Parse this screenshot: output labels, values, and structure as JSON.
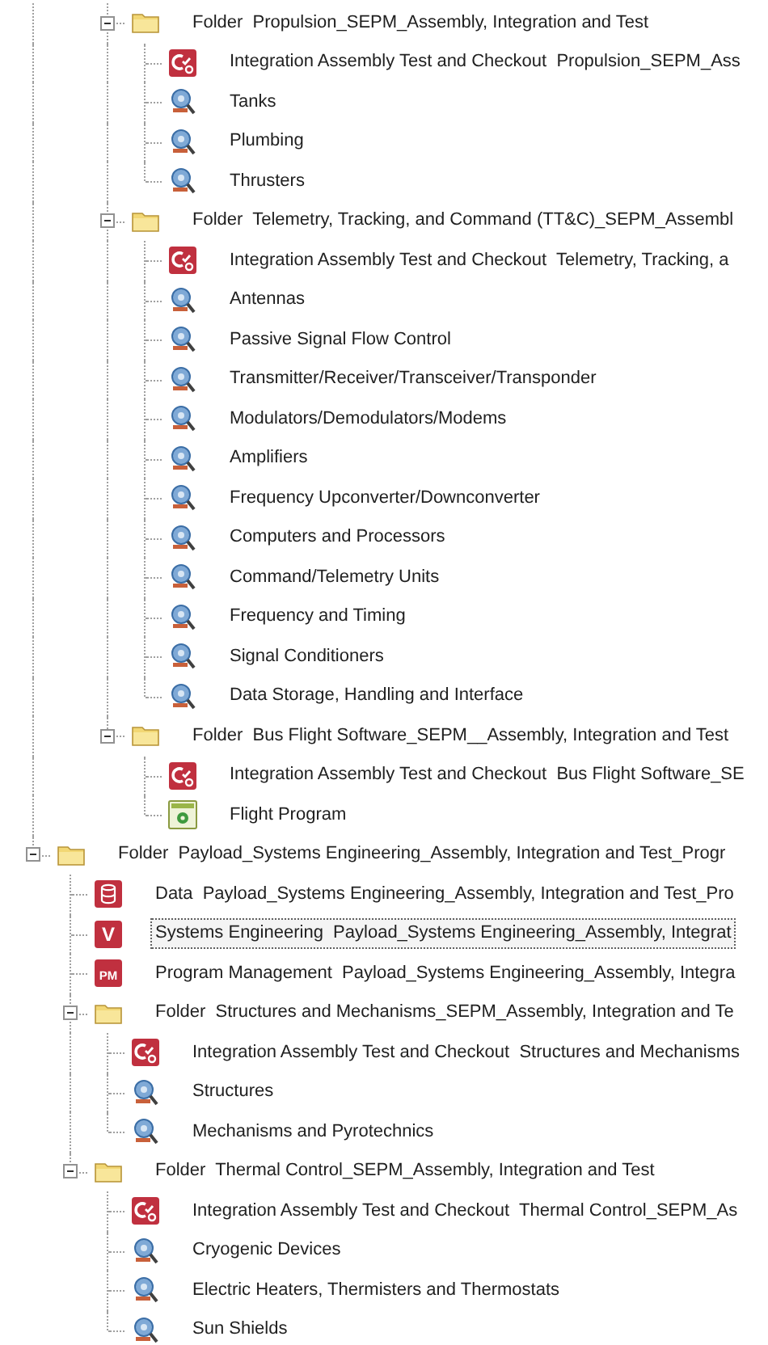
{
  "partial_branch": [
    {
      "kind": "folder",
      "label": "Folder  Propulsion_SEPM_Assembly, Integration and Test",
      "expanded": true,
      "selected": false,
      "children": [
        {
          "kind": "checkout",
          "label": "Integration Assembly Test and Checkout  Propulsion_SEPM_Ass",
          "selected": false
        },
        {
          "kind": "component",
          "label": "Tanks",
          "selected": false
        },
        {
          "kind": "component",
          "label": "Plumbing",
          "selected": false
        },
        {
          "kind": "component",
          "label": "Thrusters",
          "selected": false
        }
      ]
    },
    {
      "kind": "folder",
      "label": "Folder  Telemetry, Tracking, and Command (TT&C)_SEPM_Assembl",
      "expanded": true,
      "selected": false,
      "children": [
        {
          "kind": "checkout",
          "label": "Integration Assembly Test and Checkout  Telemetry, Tracking, a",
          "selected": false
        },
        {
          "kind": "component",
          "label": "Antennas",
          "selected": false
        },
        {
          "kind": "component",
          "label": "Passive Signal Flow Control",
          "selected": false
        },
        {
          "kind": "component",
          "label": "Transmitter/Receiver/Transceiver/Transponder",
          "selected": false
        },
        {
          "kind": "component",
          "label": "Modulators/Demodulators/Modems",
          "selected": false
        },
        {
          "kind": "component",
          "label": "Amplifiers",
          "selected": false
        },
        {
          "kind": "component",
          "label": "Frequency Upconverter/Downconverter",
          "selected": false
        },
        {
          "kind": "component",
          "label": "Computers and Processors",
          "selected": false
        },
        {
          "kind": "component",
          "label": "Command/Telemetry Units",
          "selected": false
        },
        {
          "kind": "component",
          "label": "Frequency and Timing",
          "selected": false
        },
        {
          "kind": "component",
          "label": "Signal Conditioners",
          "selected": false
        },
        {
          "kind": "component",
          "label": "Data Storage, Handling and Interface",
          "selected": false
        }
      ]
    },
    {
      "kind": "folder",
      "label": "Folder  Bus Flight Software_SEPM__Assembly, Integration and Test",
      "expanded": true,
      "selected": false,
      "children": [
        {
          "kind": "checkout",
          "label": "Integration Assembly Test and Checkout  Bus Flight Software_SE",
          "selected": false
        },
        {
          "kind": "program",
          "label": "Flight Program",
          "selected": false
        }
      ]
    }
  ],
  "tree": [
    {
      "kind": "folder",
      "label": "Folder  Payload_Systems Engineering_Assembly, Integration and Test_Progr",
      "expanded": true,
      "selected": false,
      "children": [
        {
          "kind": "data",
          "label": "Data  Payload_Systems Engineering_Assembly, Integration and Test_Pro",
          "selected": false
        },
        {
          "kind": "badge",
          "badge": "V",
          "label": "Systems Engineering  Payload_Systems Engineering_Assembly, Integrat",
          "selected": true
        },
        {
          "kind": "badge",
          "badge": "PM",
          "label": "Program Management  Payload_Systems Engineering_Assembly, Integra",
          "selected": false
        },
        {
          "kind": "folder",
          "label": "Folder  Structures and Mechanisms_SEPM_Assembly, Integration and Te",
          "expanded": true,
          "selected": false,
          "children": [
            {
              "kind": "checkout",
              "label": "Integration Assembly Test and Checkout  Structures and Mechanisms",
              "selected": false
            },
            {
              "kind": "component",
              "label": "Structures",
              "selected": false
            },
            {
              "kind": "component",
              "label": "Mechanisms and Pyrotechnics",
              "selected": false
            }
          ]
        },
        {
          "kind": "folder",
          "label": "Folder  Thermal Control_SEPM_Assembly, Integration and Test",
          "expanded": true,
          "selected": false,
          "children": [
            {
              "kind": "checkout",
              "label": "Integration Assembly Test and Checkout  Thermal Control_SEPM_As",
              "selected": false
            },
            {
              "kind": "component",
              "label": "Cryogenic Devices",
              "selected": false
            },
            {
              "kind": "component",
              "label": "Electric Heaters, Thermisters and Thermostats",
              "selected": false
            },
            {
              "kind": "component",
              "label": "Sun Shields",
              "selected": false
            }
          ]
        }
      ]
    }
  ]
}
